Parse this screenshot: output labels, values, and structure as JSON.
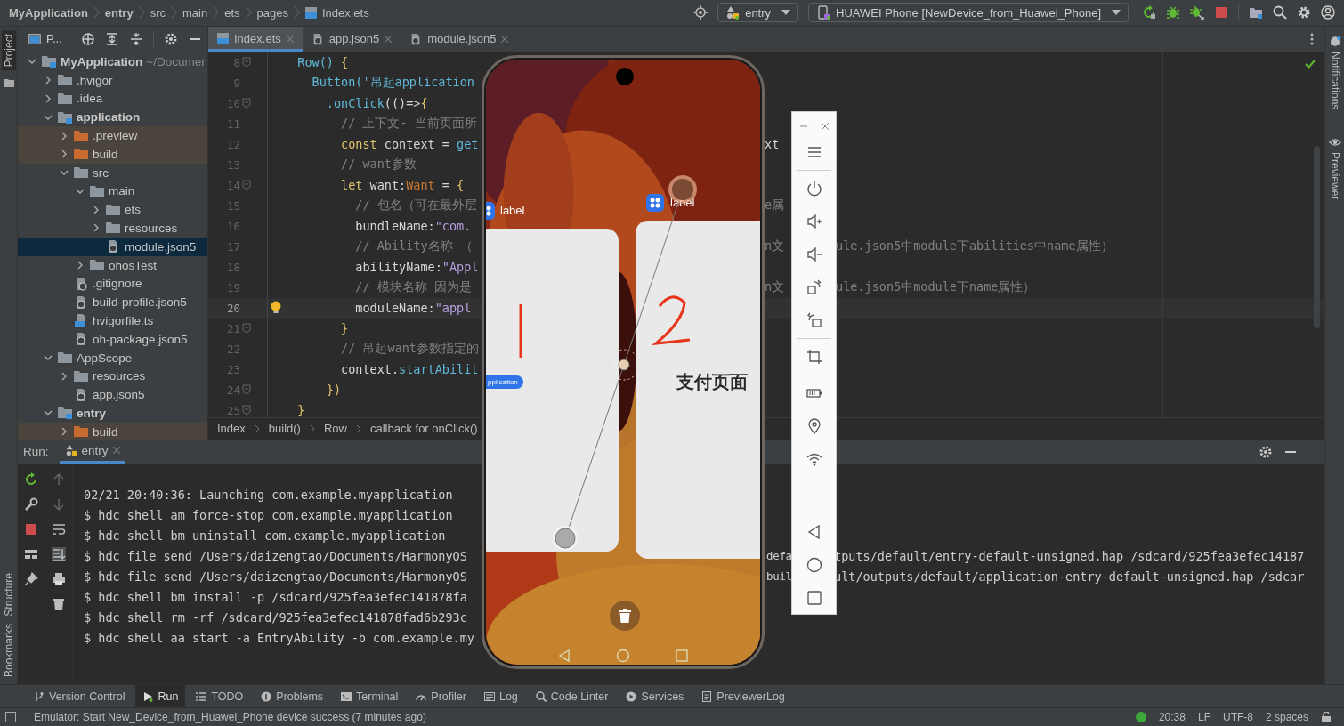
{
  "breadcrumbs": [
    {
      "label": "MyApplication",
      "bold": true,
      "kind": "text"
    },
    {
      "label": "entry",
      "bold": true,
      "kind": "text"
    },
    {
      "label": "src",
      "bold": false,
      "kind": "text"
    },
    {
      "label": "main",
      "bold": false,
      "kind": "text"
    },
    {
      "label": "ets",
      "bold": false,
      "kind": "text"
    },
    {
      "label": "pages",
      "bold": false,
      "kind": "text"
    },
    {
      "label": "Index.ets",
      "bold": false,
      "kind": "ets"
    }
  ],
  "run_config": "entry",
  "device": "HUAWEI Phone [NewDevice_from_Huawei_Phone]",
  "left_stripe": {
    "top": [
      {
        "label": "Project",
        "selected": true
      }
    ],
    "bottom": [
      {
        "label": "Structure",
        "selected": false
      },
      {
        "label": "Bookmarks",
        "selected": false
      }
    ]
  },
  "right_stripe": [
    "Notifications",
    "Previewer"
  ],
  "project": {
    "title": "P...",
    "tree": [
      {
        "label": "MyApplication",
        "suffix": "~/Documer",
        "kind": "module",
        "expanded": true,
        "selected": false,
        "children": [
          {
            "label": ".hvigor",
            "kind": "folder",
            "expanded": false,
            "selected": false
          },
          {
            "label": ".idea",
            "kind": "folder",
            "expanded": false,
            "selected": false
          },
          {
            "label": "application",
            "kind": "module",
            "expanded": true,
            "selected": false,
            "children": [
              {
                "label": ".preview",
                "kind": "excluded",
                "expanded": false,
                "selected": false
              },
              {
                "label": "build",
                "kind": "excluded",
                "expanded": false,
                "selected": false
              },
              {
                "label": "src",
                "kind": "folder",
                "expanded": true,
                "selected": false,
                "children": [
                  {
                    "label": "main",
                    "kind": "folder",
                    "expanded": true,
                    "selected": false,
                    "children": [
                      {
                        "label": "ets",
                        "kind": "folder",
                        "expanded": false,
                        "selected": false
                      },
                      {
                        "label": "resources",
                        "kind": "folder",
                        "expanded": false,
                        "selected": false
                      },
                      {
                        "label": "module.json5",
                        "kind": "json",
                        "selected": true
                      }
                    ]
                  },
                  {
                    "label": "ohosTest",
                    "kind": "folder",
                    "expanded": false,
                    "selected": false
                  }
                ]
              },
              {
                "label": ".gitignore",
                "kind": "ignore",
                "selected": false
              },
              {
                "label": "build-profile.json5",
                "kind": "json",
                "selected": false
              },
              {
                "label": "hvigorfile.ts",
                "kind": "ts",
                "selected": false
              },
              {
                "label": "oh-package.json5",
                "kind": "json",
                "selected": false
              }
            ]
          },
          {
            "label": "AppScope",
            "kind": "folder",
            "expanded": true,
            "selected": false,
            "children": [
              {
                "label": "resources",
                "kind": "folder",
                "expanded": false,
                "selected": false
              },
              {
                "label": "app.json5",
                "kind": "json",
                "selected": false
              }
            ]
          },
          {
            "label": "entry",
            "kind": "module",
            "expanded": true,
            "selected": false,
            "children": [
              {
                "label": "build",
                "kind": "excluded",
                "expanded": false,
                "selected": false
              }
            ]
          }
        ]
      }
    ]
  },
  "editor": {
    "tabs": [
      {
        "label": "Index.ets",
        "kind": "ets",
        "selected": true
      },
      {
        "label": "app.json5",
        "kind": "json",
        "selected": false
      },
      {
        "label": "module.json5",
        "kind": "json",
        "selected": false
      }
    ],
    "lines": [
      {
        "number": "8",
        "fold": true,
        "current": false,
        "tokens": [
          {
            "kind": "fn",
            "text": "  Row()"
          },
          {
            "kind": "brace",
            "text": " {"
          }
        ]
      },
      {
        "number": "9",
        "fold": false,
        "current": false,
        "tokens": [
          {
            "kind": "fn",
            "text": "    Button('吊起application"
          }
        ]
      },
      {
        "number": "10",
        "fold": true,
        "current": false,
        "tokens": [
          {
            "kind": "fn",
            "text": "      .onClick"
          },
          {
            "kind": "plain",
            "text": "(()=>"
          },
          {
            "kind": "brace",
            "text": "{"
          }
        ]
      },
      {
        "number": "11",
        "fold": false,
        "current": false,
        "tokens": [
          {
            "kind": "comment",
            "text": "        // 上下文- 当前页面所"
          }
        ]
      },
      {
        "number": "12",
        "fold": false,
        "current": false,
        "tokens": [
          {
            "kind": "kw",
            "text": "        const"
          },
          {
            "kind": "plain",
            "text": " context = "
          },
          {
            "kind": "fn",
            "text": "get"
          }
        ],
        "mid": "xt"
      },
      {
        "number": "13",
        "fold": false,
        "current": false,
        "tokens": [
          {
            "kind": "comment",
            "text": "        // want参数"
          }
        ]
      },
      {
        "number": "14",
        "fold": true,
        "current": false,
        "tokens": [
          {
            "kind": "kw",
            "text": "        let"
          },
          {
            "kind": "plain",
            "text": " want:"
          },
          {
            "kind": "type",
            "text": "Want"
          },
          {
            "kind": "plain",
            "text": " = "
          },
          {
            "kind": "brace",
            "text": "{"
          }
        ]
      },
      {
        "number": "15",
        "fold": false,
        "current": false,
        "tokens": [
          {
            "kind": "comment",
            "text": "          // 包名（可在最外层"
          }
        ],
        "mid": "e属"
      },
      {
        "number": "16",
        "fold": false,
        "current": false,
        "tokens": [
          {
            "kind": "plain",
            "text": "          bundleName:"
          },
          {
            "kind": "str",
            "text": "\"com."
          }
        ]
      },
      {
        "number": "17",
        "fold": false,
        "current": false,
        "tokens": [
          {
            "kind": "comment",
            "text": "          // Ability名称 （"
          }
        ],
        "mid": "n文",
        "far": "ule.json5中module下abilities中name属性）"
      },
      {
        "number": "18",
        "fold": false,
        "current": false,
        "tokens": [
          {
            "kind": "plain",
            "text": "          abilityName:"
          },
          {
            "kind": "str",
            "text": "\"Appl"
          }
        ]
      },
      {
        "number": "19",
        "fold": false,
        "current": false,
        "tokens": [
          {
            "kind": "comment",
            "text": "          // 模块名称 因为是"
          }
        ],
        "mid": "n文",
        "far": "ule.json5中module下name属性）"
      },
      {
        "number": "20",
        "fold": false,
        "current": true,
        "tokens": [
          {
            "kind": "plain",
            "text": "          moduleName:"
          },
          {
            "kind": "str",
            "text": "\"appl"
          }
        ]
      },
      {
        "number": "21",
        "fold": true,
        "current": false,
        "tokens": [
          {
            "kind": "brace",
            "text": "        }"
          }
        ]
      },
      {
        "number": "22",
        "fold": false,
        "current": false,
        "tokens": [
          {
            "kind": "comment",
            "text": "        // 吊起want参数指定的"
          }
        ]
      },
      {
        "number": "23",
        "fold": false,
        "current": false,
        "tokens": [
          {
            "kind": "plain",
            "text": "        context."
          },
          {
            "kind": "fn",
            "text": "startAbilit"
          }
        ]
      },
      {
        "number": "24",
        "fold": true,
        "current": false,
        "tokens": [
          {
            "kind": "brace",
            "text": "      })"
          }
        ]
      },
      {
        "number": "25",
        "fold": true,
        "current": false,
        "tokens": [
          {
            "kind": "brace",
            "text": "  }"
          }
        ]
      }
    ],
    "breadcrumb": [
      "Index",
      "build()",
      "Row",
      "callback for onClick()"
    ]
  },
  "phone": {
    "cards": [
      {
        "label": "label",
        "kind": "button",
        "text": "pplication"
      },
      {
        "label": "label",
        "kind": "title",
        "text": "支付页面"
      }
    ]
  },
  "run": {
    "title": "Run:",
    "tab": "entry",
    "lines": [
      {
        "text": "02/21 20:40:36: Launching com.example.myapplication"
      },
      {
        "text": "$ hdc shell am force-stop com.example.myapplication"
      },
      {
        "text": "$ hdc shell bm uninstall com.example.myapplication"
      },
      {
        "text": "$ hdc file send /Users/daizengtao/Documents/HarmonyOS",
        "mid": "defa",
        "far": "tputs/default/entry-default-unsigned.hap /sdcard/925fea3efec14187"
      },
      {
        "text": "$ hdc file send /Users/daizengtao/Documents/HarmonyOS",
        "mid": "buil",
        "far": "ult/outputs/default/application-entry-default-unsigned.hap /sdcar"
      },
      {
        "text": "$ hdc shell bm install -p /sdcard/925fea3efec141878fa"
      },
      {
        "text": "$ hdc shell rm -rf /sdcard/925fea3efec141878fad6b293c"
      },
      {
        "text": "$ hdc shell aa start -a EntryAbility -b com.example.my"
      }
    ]
  },
  "tool_windows": [
    {
      "label": "Version Control",
      "kind": "vcs",
      "selected": false
    },
    {
      "label": "Run",
      "kind": "run",
      "selected": true
    },
    {
      "label": "TODO",
      "kind": "todo",
      "selected": false
    },
    {
      "label": "Problems",
      "kind": "problems",
      "selected": false
    },
    {
      "label": "Terminal",
      "kind": "terminal",
      "selected": false
    },
    {
      "label": "Profiler",
      "kind": "profiler",
      "selected": false
    },
    {
      "label": "Log",
      "kind": "log",
      "selected": false
    },
    {
      "label": "Code Linter",
      "kind": "linter",
      "selected": false
    },
    {
      "label": "Services",
      "kind": "services",
      "selected": false
    },
    {
      "label": "PreviewerLog",
      "kind": "doc",
      "selected": false
    }
  ],
  "status": {
    "message": "Emulator: Start New_Device_from_Huawei_Phone device success (7 minutes ago)",
    "items": [
      "20:38",
      "LF",
      "UTF-8",
      "2 spaces"
    ]
  }
}
